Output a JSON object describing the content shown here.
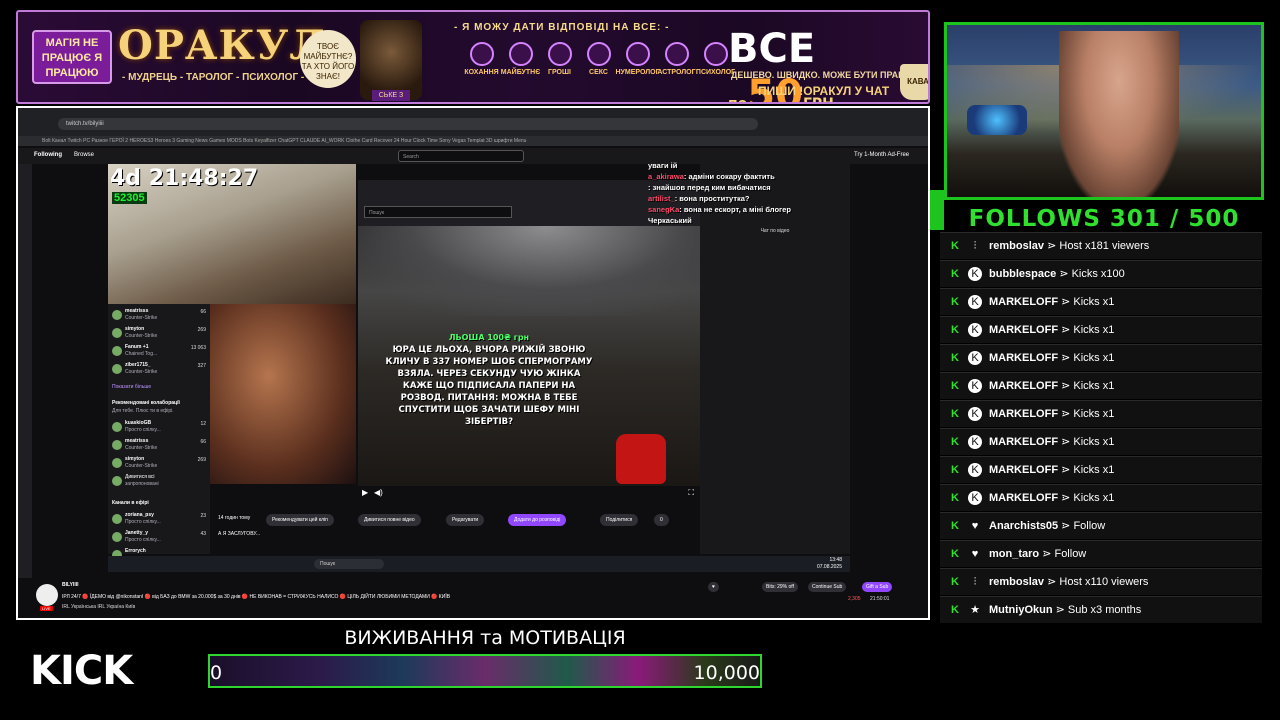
{
  "banner": {
    "left_note": "МАГІЯ НЕ ПРАЦЮЄ Я ПРАЦЮЮ",
    "title": "ОРАКУЛ",
    "subtitle": "- МУДРЕЦЬ - ТАРОЛОГ - ПСИХОЛОГ -",
    "bubble": "ТВОЄ МАЙБУТНЄ? ТА ХТО ЙОГО ЗНАЄ!",
    "wizard_tag": "СЬКЕ З ТЕБЕ",
    "headline": "- Я МОЖУ ДАТИ ВІДПОВІДІ НА ВСЕ: -",
    "icons": [
      "КОХАННЯ",
      "МАЙБУТНЄ",
      "ГРОШІ",
      "СЕКС",
      "НУМЕРОЛОГ",
      "АСТРОЛОГ",
      "ПСИХОЛОГ"
    ],
    "price_all": "ВСЕ",
    "price_po": "по",
    "price_num": "50",
    "price_cur": "ГРН.",
    "cheap_line": "ДЕШЕВО. ШВИДКО. МОЖЕ БУТИ ПРАВДА.",
    "write_line": "ПИШИ !ОРАКУЛ У ЧАТ",
    "cup_text": "КАВА"
  },
  "capture": {
    "url": "twitch.tv/bilyiiii",
    "bookmarks": "Bolt   Канал   Twitch   PC   Разное   ГЕРОЇ 2   HEROES3   Heroes 3   Gaming News   Games   MODS   Bots   Keyalfizer   ChatGPT   CLAUDE   AI_WORK   Clothe Card Recover   24 Hour Clock Time   Sony Vegas Templat   3D шрифти   Menu",
    "nav_following": "Following",
    "nav_browse": "Browse",
    "nav_search": "Search",
    "nav_ad": "Try 1-Month Ad-Free",
    "timer": "4d 21:48:27",
    "score": "52305",
    "inner_search": "Пошук",
    "side_rows": [
      {
        "name": "meatrisss",
        "game": "Counter-Strike",
        "viewers": "66"
      },
      {
        "name": "simyton",
        "game": "Counter-Strike",
        "viewers": "269"
      },
      {
        "name": "Fanum +1",
        "game": "Chained Tog...",
        "viewers": "13 063"
      },
      {
        "name": "ziber1715_",
        "game": "Counter-Strike",
        "viewers": "327"
      }
    ],
    "show_more": "Показати більше",
    "recommended": "Рекомендовані колаборації",
    "recommended_sub": "Для тебе. Плюс ти в ефірі.",
    "rec_rows": [
      {
        "name": "kuaskioGB",
        "game": "Просто спілку...",
        "viewers": "12"
      },
      {
        "name": "meatrisss",
        "game": "Counter-Strike",
        "viewers": "66"
      },
      {
        "name": "simyton",
        "game": "Counter-Strike",
        "viewers": "269"
      },
      {
        "name": "Дивитися всі",
        "game": "запропоновані",
        "viewers": ""
      }
    ],
    "live_channels": "Канали в ефірі",
    "live_rows": [
      {
        "name": "zoriana_psy",
        "game": "Просто спілку...",
        "viewers": "23"
      },
      {
        "name": "Janetty_y",
        "game": "Просто спілку...",
        "viewers": "43"
      },
      {
        "name": "Errorych",
        "game": "Просто спілку...",
        "viewers": ""
      }
    ],
    "donation_head": "ЛЬОША 100₴ грн",
    "donation_text": "ЮРА ЦЕ ЛЬОХА, ВЧОРА РИЖІЙ ЗВОНЮ КЛИЧУ В 337 НОМЕР ШОБ СПЕРМОГРАМУ ВЗЯЛА. ЧЕРЕЗ СЕКУНДУ ЧУЮ ЖІНКА КАЖЕ ЩО ПІДПИСАЛА ПАПЕРИ НА РОЗВОД. ПИТАННЯ: МОЖНА В ТЕБЕ СПУСТИТИ ЩОБ ЗАЧАТИ ШЕФУ МІНІ ЗІБЕРТІВ?",
    "overlay_chat": [
      {
        "user": "",
        "msg": "уваги ій"
      },
      {
        "user": "a_akirawa",
        "msg": ": адміни сокару фактить"
      },
      {
        "user": "",
        "msg": ": знайшов перед ким вибачатися"
      },
      {
        "user": "artilist_",
        "msg": ": вона проститутка?"
      },
      {
        "user": "sanegKa",
        "msg": ": вона не ескорт, а мiнi блогер"
      },
      {
        "user": "",
        "msg": "Черкаський"
      }
    ],
    "chat_header": "Чат по відео",
    "clip_age": "14 годин тому",
    "clip_title": "А Я ЗАСЛУГОВУ...",
    "clip_buttons": [
      "Рекомендувати цей кліп",
      "Дивитися повне відео",
      "Редагувати",
      "Додати до розповіді",
      "Поділитися",
      "0"
    ],
    "taskbar_search": "Пошук",
    "taskbar_time": "13:48",
    "taskbar_date": "07.08.2025",
    "streamer": "BILYIIII",
    "stream_title": "ІРЛ 24/7 🔴 ЇДЕМО від @nikonstanl 🔴 від БАЗ до BMW за 20.000$ за 30 днів 🔴 НЕ ВИКОНАВ = СТРИЖУСЬ НАЛИСО 🔴 ЦІЛЬ ДІЙТИ ЛЮБИМИ МЕТОДАМИ 🔴 КИЇВ",
    "stream_tags": "IRL   Українська   IRL   Україна   Київ",
    "live_badge": "LIVE",
    "bits_btn": "Bits: 29% off",
    "continue_sub": "Continue Sub",
    "gift_sub": "Gift a Sub",
    "viewer_count": "2,305",
    "uptime": "21:50:01"
  },
  "bottom": {
    "kick_logo": "KICK",
    "goal_title": "ВИЖИВАННЯ та МОТИВАЦІЯ",
    "goal_start": "0",
    "goal_end": "10,000",
    "goal_progress": 0
  },
  "right": {
    "follows": "FOLLOWS 301 / 500",
    "events": [
      {
        "icon": "host-icon",
        "glyph": "⫶",
        "user": "remboslav",
        "action": "Host x181 viewers"
      },
      {
        "icon": "kick-icon",
        "glyph": "K",
        "user": "bubblespace",
        "action": "Kicks x100"
      },
      {
        "icon": "kick-icon",
        "glyph": "K",
        "user": "MARKELOFF",
        "action": "Kicks x1"
      },
      {
        "icon": "kick-icon",
        "glyph": "K",
        "user": "MARKELOFF",
        "action": "Kicks x1"
      },
      {
        "icon": "kick-icon",
        "glyph": "K",
        "user": "MARKELOFF",
        "action": "Kicks x1"
      },
      {
        "icon": "kick-icon",
        "glyph": "K",
        "user": "MARKELOFF",
        "action": "Kicks x1"
      },
      {
        "icon": "kick-icon",
        "glyph": "K",
        "user": "MARKELOFF",
        "action": "Kicks x1"
      },
      {
        "icon": "kick-icon",
        "glyph": "K",
        "user": "MARKELOFF",
        "action": "Kicks x1"
      },
      {
        "icon": "kick-icon",
        "glyph": "K",
        "user": "MARKELOFF",
        "action": "Kicks x1"
      },
      {
        "icon": "kick-icon",
        "glyph": "K",
        "user": "MARKELOFF",
        "action": "Kicks x1"
      },
      {
        "icon": "heart-icon",
        "glyph": "♥",
        "user": "Anarchists05",
        "action": "Follow"
      },
      {
        "icon": "heart-icon",
        "glyph": "♥",
        "user": "mon_taro",
        "action": "Follow"
      },
      {
        "icon": "host-icon",
        "glyph": "⫶",
        "user": "remboslav",
        "action": "Host x110 viewers"
      },
      {
        "icon": "star-icon",
        "glyph": "★",
        "user": "MutniyOkun",
        "action": "Sub x3 months"
      }
    ],
    "arrow": "⋗",
    "kick_glyph": "K",
    "accent": "#2fe02f"
  }
}
